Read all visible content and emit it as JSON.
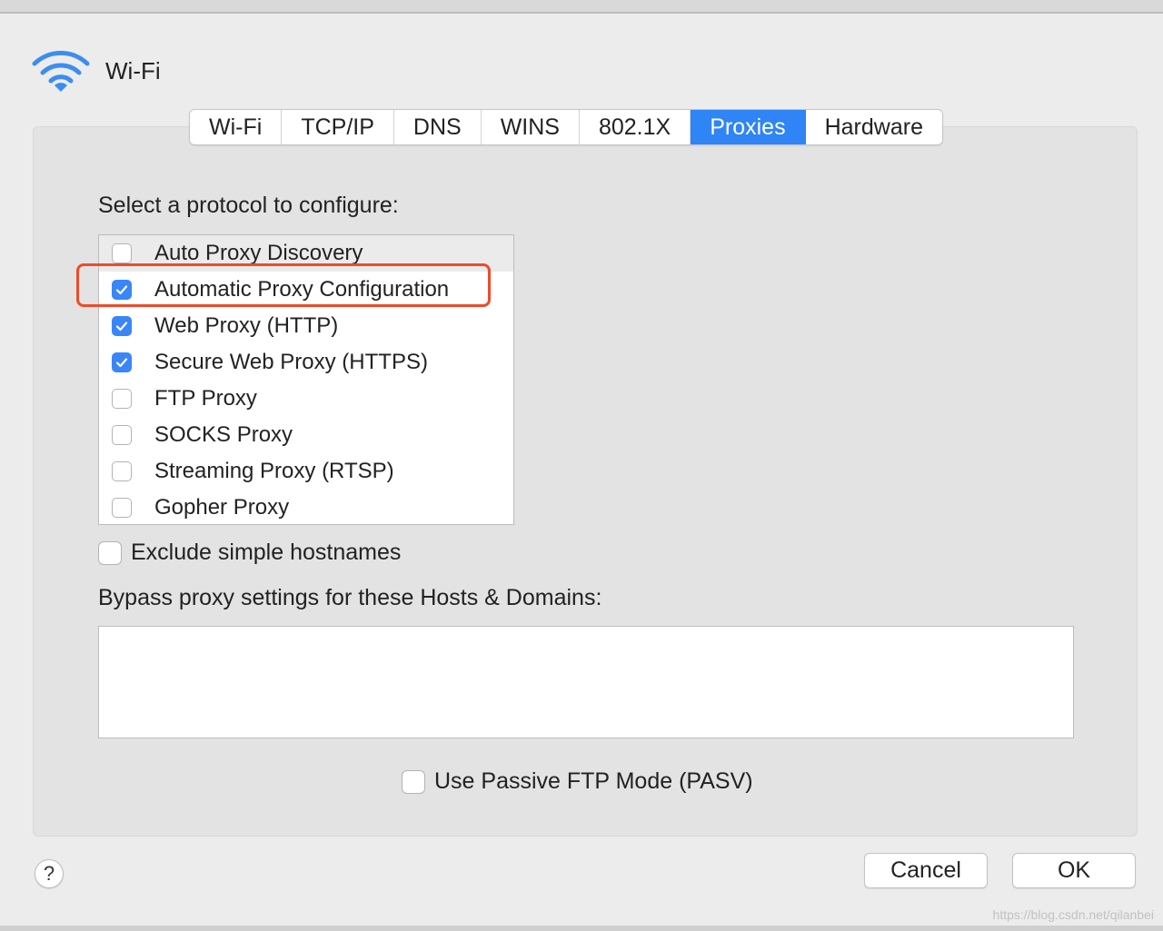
{
  "window": {
    "title": "Wi-Fi",
    "icon": "wifi-icon",
    "accent_color": "#2f84f6"
  },
  "tabs": [
    {
      "label": "Wi-Fi",
      "active": false
    },
    {
      "label": "TCP/IP",
      "active": false
    },
    {
      "label": "DNS",
      "active": false
    },
    {
      "label": "WINS",
      "active": false
    },
    {
      "label": "802.1X",
      "active": false
    },
    {
      "label": "Proxies",
      "active": true
    },
    {
      "label": "Hardware",
      "active": false
    }
  ],
  "proxies": {
    "select_label": "Select a protocol to configure:",
    "protocols": [
      {
        "label": "Auto Proxy Discovery",
        "checked": false
      },
      {
        "label": "Automatic Proxy Configuration",
        "checked": true
      },
      {
        "label": "Web Proxy (HTTP)",
        "checked": true
      },
      {
        "label": "Secure Web Proxy (HTTPS)",
        "checked": true
      },
      {
        "label": "FTP Proxy",
        "checked": false
      },
      {
        "label": "SOCKS Proxy",
        "checked": false
      },
      {
        "label": "Streaming Proxy (RTSP)",
        "checked": false
      },
      {
        "label": "Gopher Proxy",
        "checked": false
      }
    ],
    "exclude_simple": {
      "label": "Exclude simple hostnames",
      "checked": false
    },
    "bypass_label": "Bypass proxy settings for these Hosts & Domains:",
    "bypass_value": "",
    "passive_ftp": {
      "label": "Use Passive FTP Mode (PASV)",
      "checked": false
    }
  },
  "annotation": {
    "highlight_color": "#ee4b2b"
  },
  "footer": {
    "help_label": "?",
    "cancel_label": "Cancel",
    "ok_label": "OK"
  },
  "watermark": "https://blog.csdn.net/qilanbei"
}
